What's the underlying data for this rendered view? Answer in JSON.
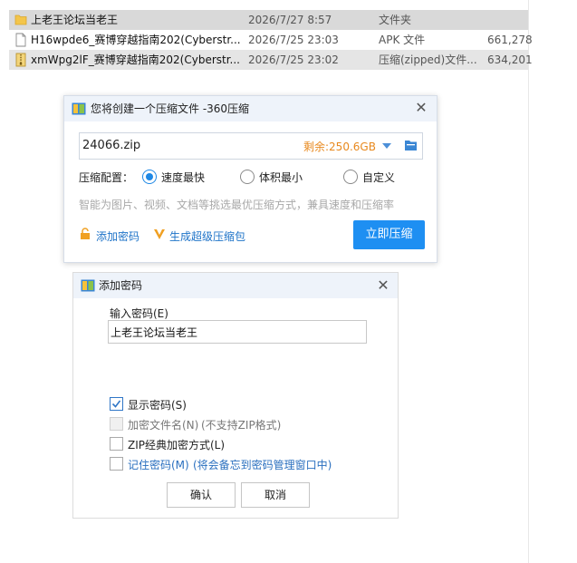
{
  "file_list": [
    {
      "name": "上老王论坛当老王",
      "date": "2026/7/27 8:57",
      "type": "文件夹",
      "size": "",
      "icon": "folder-icon"
    },
    {
      "name": "H16wpde6_赛博穿越指南202(Cyberstr...",
      "date": "2026/7/25 23:03",
      "type": "APK 文件",
      "size": "661,278",
      "icon": "file-icon"
    },
    {
      "name": "xmWpg2lF_赛博穿越指南202(Cyberstr...",
      "date": "2026/7/25 23:02",
      "type": "压缩(zipped)文件...",
      "size": "634,201",
      "icon": "zip-file-icon"
    }
  ],
  "compress_dialog": {
    "title": "您将创建一个压缩文件 -360压缩",
    "filename": "24066.zip",
    "free_space": "剩余:250.6GB",
    "config_label": "压缩配置：",
    "options": [
      "速度最快",
      "体积最小",
      "自定义"
    ],
    "selected_option": "速度最快",
    "hint": "智能为图片、视频、文档等挑选最优压缩方式，兼具速度和压缩率",
    "add_password_link": "添加密码",
    "super_pack_link": "生成超级压缩包",
    "compress_button": "立即压缩",
    "accent_color": "#1e8ff2",
    "free_space_color": "#e8891e"
  },
  "password_dialog": {
    "title": "添加密码",
    "input_label": "输入密码(E)",
    "password_value": "上老王论坛当老王",
    "show_password": "显示密码(S)",
    "encrypt_filename": "加密文件名(N)",
    "encrypt_filename_note": "(不支持ZIP格式)",
    "zip_classic": "ZIP经典加密方式(L)",
    "remember_password": "记住密码(M)",
    "remember_note": "(将会备忘到密码管理窗口中)",
    "ok_button": "确认",
    "cancel_button": "取消"
  }
}
